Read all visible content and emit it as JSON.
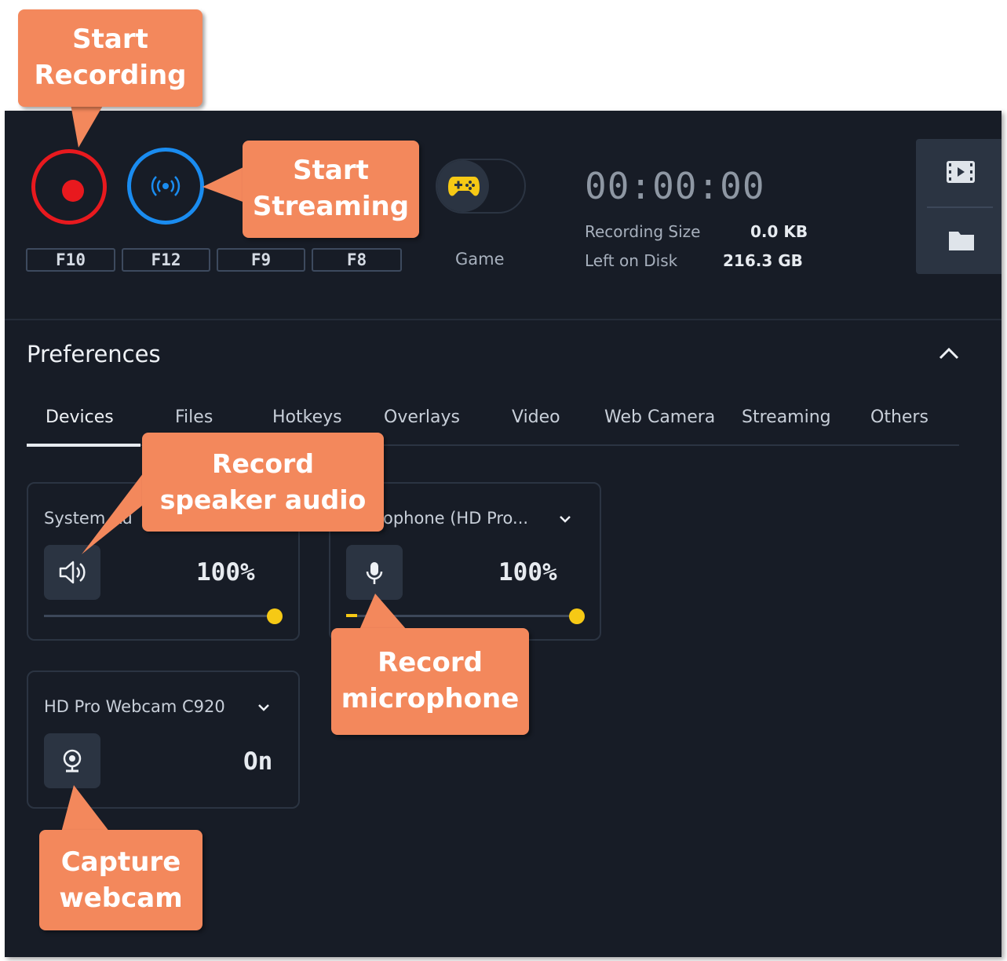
{
  "recorder": {
    "hotkeys": [
      "F10",
      "F12",
      "F9",
      "F8"
    ],
    "game_label": "Game",
    "timer": "00:00:00",
    "recording_size_label": "Recording Size",
    "recording_size_value": "0.0 KB",
    "left_on_disk_label": "Left on Disk",
    "left_on_disk_value": "216.3 GB"
  },
  "preferences": {
    "title": "Preferences",
    "tabs": [
      "Devices",
      "Files",
      "Hotkeys",
      "Overlays",
      "Video",
      "Web Camera",
      "Streaming",
      "Others"
    ],
    "active_tab": "Devices",
    "devices": {
      "system_audio": {
        "title": "System Au",
        "volume": "100%"
      },
      "microphone": {
        "title": "ophone (HD Pro...",
        "volume": "100%"
      },
      "webcam": {
        "title": "HD Pro Webcam C920",
        "state": "On"
      }
    }
  },
  "callouts": {
    "start_recording": [
      "Start",
      "Recording"
    ],
    "start_streaming": [
      "Start",
      "Streaming"
    ],
    "record_speaker": [
      "Record",
      "speaker audio"
    ],
    "record_microphone": [
      "Record",
      "microphone"
    ],
    "capture_webcam": [
      "Capture",
      "webcam"
    ]
  },
  "colors": {
    "app_background": "#171c26",
    "record_red": "#e8191e",
    "stream_blue": "#1a8cf0",
    "level_yellow": "#f6c915",
    "callout_orange": "#f3885c"
  },
  "icons": [
    "record-icon",
    "broadcast-icon",
    "gamepad-icon",
    "film-icon",
    "folder-icon",
    "chevron-up-icon",
    "speaker-icon",
    "microphone-icon",
    "webcam-icon",
    "chevron-down-icon"
  ]
}
